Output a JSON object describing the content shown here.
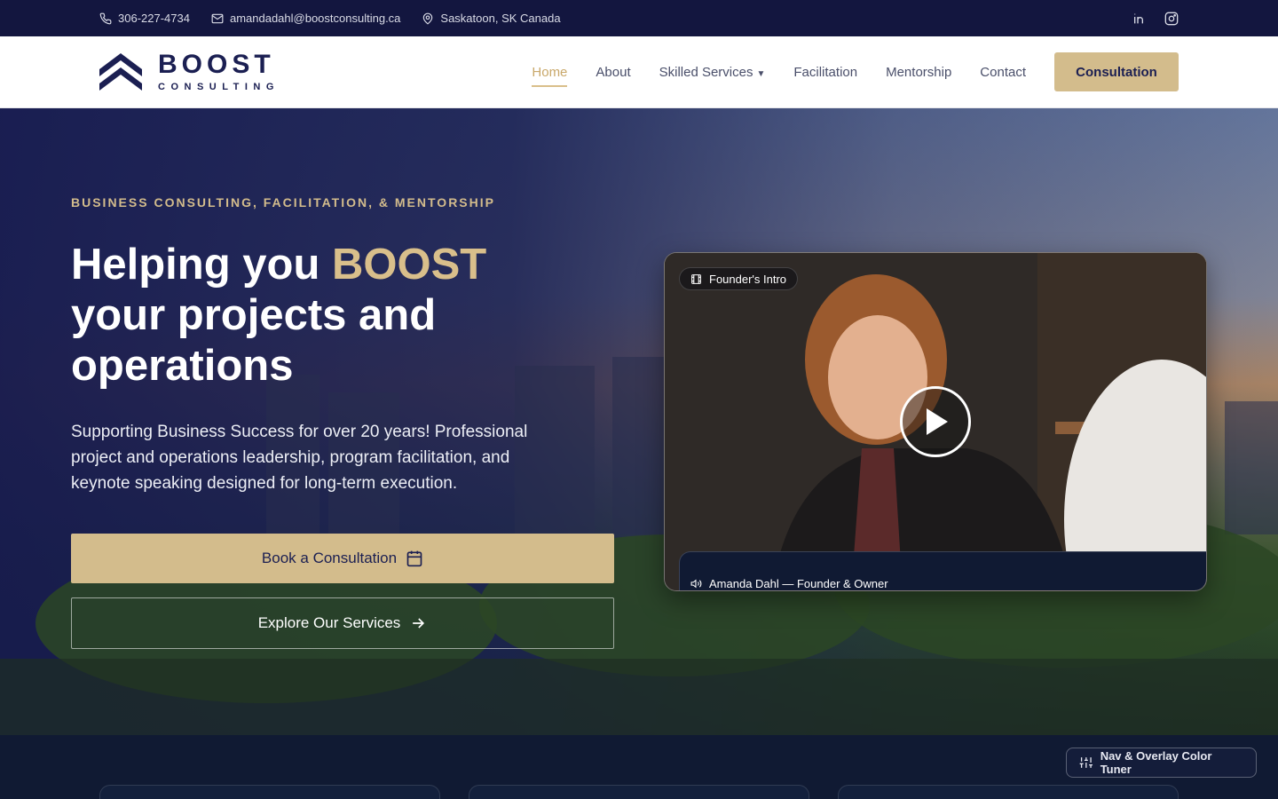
{
  "topbar": {
    "phone": "306-227-4734",
    "email": "amandadahl@boostconsulting.ca",
    "location": "Saskatoon, SK Canada",
    "icons": [
      "phone-icon",
      "mail-icon",
      "map-pin-icon",
      "linkedin-icon",
      "instagram-icon"
    ]
  },
  "brand": {
    "name": "BOOST",
    "tagline": "CONSULTING"
  },
  "nav": {
    "items": [
      {
        "label": "Home",
        "active": true
      },
      {
        "label": "About"
      },
      {
        "label": "Skilled Services",
        "dropdown": true
      },
      {
        "label": "Facilitation"
      },
      {
        "label": "Mentorship"
      },
      {
        "label": "Contact"
      }
    ],
    "cta": "Consultation"
  },
  "hero": {
    "eyebrow": "BUSINESS CONSULTING, FACILITATION, & MENTORSHIP",
    "headline_prefix": "Helping you ",
    "headline_accent": "BOOST",
    "headline_rest_1": "your projects and",
    "headline_rest_2": "operations",
    "description": "Supporting Business Success for over 20 years! Professional project and operations leadership, program facilitation, and keynote speaking designed for long-term execution.",
    "primary_button": "Book a Consultation",
    "secondary_button": "Explore Our Services"
  },
  "video": {
    "tag": "Founder's Intro",
    "caption": "Amanda Dahl — Founder & Owner"
  },
  "tuner": {
    "label": "Nav & Overlay Color Tuner"
  },
  "colors": {
    "navy": "#13163f",
    "gold": "#d3bc8c",
    "brand_text": "#1b1f52",
    "bottom_bg": "#101a33"
  }
}
